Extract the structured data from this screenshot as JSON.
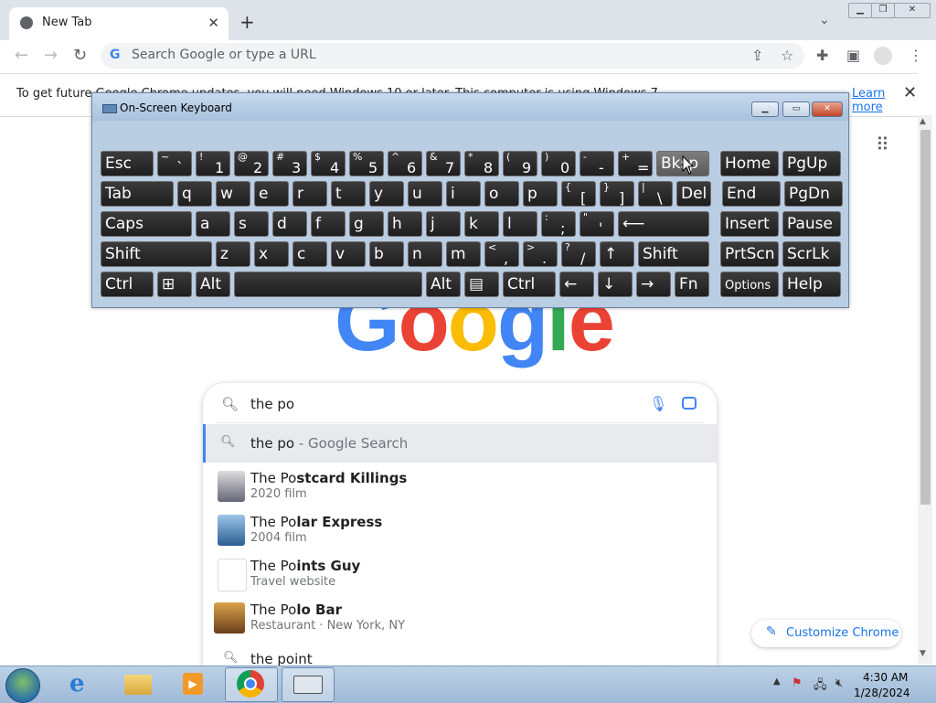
{
  "browser": {
    "tab_title": "New Tab",
    "tab_close": "✕",
    "new_tab": "+",
    "tab_list": "⌄",
    "omnibox_g": "G",
    "omnibox_placeholder": "Search Google or type a URL",
    "icons": [
      "back-icon",
      "forward-icon",
      "reload-icon",
      "share-icon",
      "star-icon",
      "extensions-icon",
      "sidepanel-icon",
      "profile-icon",
      "menu-icon"
    ]
  },
  "infobar": {
    "text": "To get future Google Chrome updates, you will need Windows 10 or later. This computer is using Windows 7.",
    "link": "Learn more",
    "close": "✕"
  },
  "logo": [
    "G",
    "o",
    "o",
    "g",
    "l",
    "e"
  ],
  "search": {
    "query": "the po",
    "first_suggestion_bold": "the po",
    "first_suggestion_rest": " - Google Search",
    "suggestions": [
      {
        "prefix": "The Po",
        "rest": "stcard Killings",
        "sub": "2020 film"
      },
      {
        "prefix": "The Po",
        "rest": "lar Express",
        "sub": "2004 film"
      },
      {
        "prefix": "The Po",
        "rest": "ints Guy",
        "sub": "Travel website"
      },
      {
        "prefix": "The Po",
        "rest": "lo Bar",
        "sub": "Restaurant · New York, NY"
      }
    ],
    "last_suggestion": "the point"
  },
  "customize_label": "Customize Chrome",
  "osk": {
    "title": "On-Screen Keyboard",
    "rows": [
      [
        {
          "m": "Esc",
          "w": 58
        },
        {
          "s": "~",
          "b": "`",
          "w": 38
        },
        {
          "s": "!",
          "b": "1",
          "w": 38
        },
        {
          "s": "@",
          "b": "2",
          "w": 38
        },
        {
          "s": "#",
          "b": "3",
          "w": 38
        },
        {
          "s": "$",
          "b": "4",
          "w": 38
        },
        {
          "s": "%",
          "b": "5",
          "w": 38
        },
        {
          "s": "^",
          "b": "6",
          "w": 38
        },
        {
          "s": "&",
          "b": "7",
          "w": 38
        },
        {
          "s": "*",
          "b": "8",
          "w": 38
        },
        {
          "s": "(",
          "b": "9",
          "w": 38
        },
        {
          "s": ")",
          "b": "0",
          "w": 38
        },
        {
          "s": "-",
          "b": "-",
          "w": 38
        },
        {
          "s": "+",
          "b": "=",
          "w": 38
        },
        {
          "m": "Bksp",
          "w": 58,
          "hover": true
        },
        {
          "m": "Home",
          "w": 64,
          "gap": 8
        },
        {
          "m": "PgUp",
          "w": 64
        }
      ],
      [
        {
          "m": "Tab",
          "w": 80
        },
        {
          "m": "q",
          "w": 38
        },
        {
          "m": "w",
          "w": 38
        },
        {
          "m": "e",
          "w": 38
        },
        {
          "m": "r",
          "w": 38
        },
        {
          "m": "t",
          "w": 38
        },
        {
          "m": "y",
          "w": 38
        },
        {
          "m": "u",
          "w": 38
        },
        {
          "m": "i",
          "w": 38
        },
        {
          "m": "o",
          "w": 38
        },
        {
          "m": "p",
          "w": 38
        },
        {
          "s": "{",
          "b": "[",
          "w": 38
        },
        {
          "s": "}",
          "b": "]",
          "w": 38
        },
        {
          "s": "|",
          "b": "\\",
          "w": 38
        },
        {
          "m": "Del",
          "w": 38
        },
        {
          "m": "End",
          "w": 64,
          "gap": 8
        },
        {
          "m": "PgDn",
          "w": 64
        }
      ],
      [
        {
          "m": "Caps",
          "w": 100
        },
        {
          "m": "a",
          "w": 38
        },
        {
          "m": "s",
          "w": 38
        },
        {
          "m": "d",
          "w": 38
        },
        {
          "m": "f",
          "w": 38
        },
        {
          "m": "g",
          "w": 38
        },
        {
          "m": "h",
          "w": 38
        },
        {
          "m": "j",
          "w": 38
        },
        {
          "m": "k",
          "w": 38
        },
        {
          "m": "l",
          "w": 38
        },
        {
          "s": ":",
          "b": ";",
          "w": 38
        },
        {
          "s": "\"",
          "b": "'",
          "w": 38
        },
        {
          "m": "⟵",
          "w": 100
        },
        {
          "m": "Insert",
          "w": 64,
          "gap": 8
        },
        {
          "m": "Pause",
          "w": 64
        }
      ],
      [
        {
          "m": "Shift",
          "w": 122
        },
        {
          "m": "z",
          "w": 38
        },
        {
          "m": "x",
          "w": 38
        },
        {
          "m": "c",
          "w": 38
        },
        {
          "m": "v",
          "w": 38
        },
        {
          "m": "b",
          "w": 38
        },
        {
          "m": "n",
          "w": 38
        },
        {
          "m": "m",
          "w": 38
        },
        {
          "s": "<",
          "b": ",",
          "w": 38
        },
        {
          "s": ">",
          "b": ".",
          "w": 38
        },
        {
          "s": "?",
          "b": "/",
          "w": 38
        },
        {
          "m": "↑",
          "w": 38
        },
        {
          "m": "Shift",
          "w": 78
        },
        {
          "m": "PrtScn",
          "w": 64,
          "gap": 8
        },
        {
          "m": "ScrLk",
          "w": 64
        }
      ],
      [
        {
          "m": "Ctrl",
          "w": 58
        },
        {
          "m": "⊞",
          "w": 38
        },
        {
          "m": "Alt",
          "w": 38
        },
        {
          "m": "",
          "w": 206
        },
        {
          "m": "Alt",
          "w": 38
        },
        {
          "m": "▤",
          "w": 38
        },
        {
          "m": "Ctrl",
          "w": 58
        },
        {
          "m": "←",
          "w": 38
        },
        {
          "m": "↓",
          "w": 38
        },
        {
          "m": "→",
          "w": 38
        },
        {
          "m": "Fn",
          "w": 38
        },
        {
          "m": "Options",
          "w": 64,
          "gap": 8,
          "small": true
        },
        {
          "m": "Help",
          "w": 64
        }
      ]
    ]
  },
  "taskbar": {
    "time": "4:30 AM",
    "date": "1/28/2024",
    "apps": [
      "ie-icon",
      "explorer-icon",
      "media-player-icon",
      "chrome-icon",
      "osk-icon"
    ]
  }
}
